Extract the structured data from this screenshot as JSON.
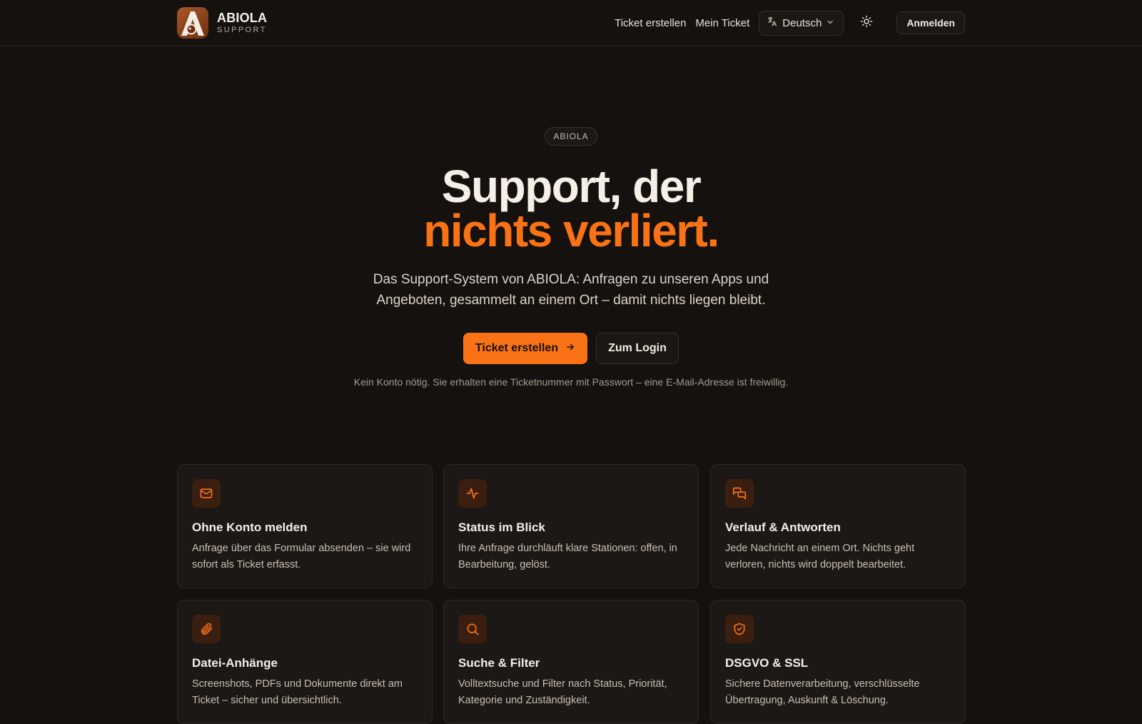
{
  "brand": {
    "name": "ABIOLA",
    "sub": "SUPPORT"
  },
  "nav": {
    "create_ticket": "Ticket erstellen",
    "my_ticket": "Mein Ticket",
    "language": "Deutsch",
    "login": "Anmelden"
  },
  "hero": {
    "badge": "ABIOLA",
    "headline_line1": "Support, der",
    "headline_line2": "nichts verliert.",
    "lead": "Das Support-System von ABIOLA: Anfragen zu unseren Apps und Angeboten, gesammelt an einem Ort – damit nichts liegen bleibt.",
    "cta_primary": "Ticket erstellen",
    "cta_secondary": "Zum Login",
    "note": "Kein Konto nötig. Sie erhalten eine Ticketnummer mit Passwort – eine E-Mail-Adresse ist freiwillig."
  },
  "features": [
    {
      "icon": "mail-icon",
      "title": "Ohne Konto melden",
      "desc": "Anfrage über das Formular absenden – sie wird sofort als Ticket erfasst."
    },
    {
      "icon": "activity-icon",
      "title": "Status im Blick",
      "desc": "Ihre Anfrage durchläuft klare Stationen: offen, in Bearbeitung, gelöst."
    },
    {
      "icon": "chat-icon",
      "title": "Verlauf & Antworten",
      "desc": "Jede Nachricht an einem Ort. Nichts geht verloren, nichts wird doppelt bearbeitet."
    },
    {
      "icon": "paperclip-icon",
      "title": "Datei-Anhänge",
      "desc": "Screenshots, PDFs und Dokumente direkt am Ticket – sicher und übersichtlich."
    },
    {
      "icon": "search-icon",
      "title": "Suche & Filter",
      "desc": "Volltextsuche und Filter nach Status, Priorität, Kategorie und Zuständigkeit."
    },
    {
      "icon": "shield-check-icon",
      "title": "DSGVO & SSL",
      "desc": "Sichere Datenverarbeitung, verschlüsselte Übertragung, Auskunft & Löschung."
    }
  ],
  "colors": {
    "accent": "#f97316",
    "background": "#15110e",
    "card": "#1c1815"
  }
}
